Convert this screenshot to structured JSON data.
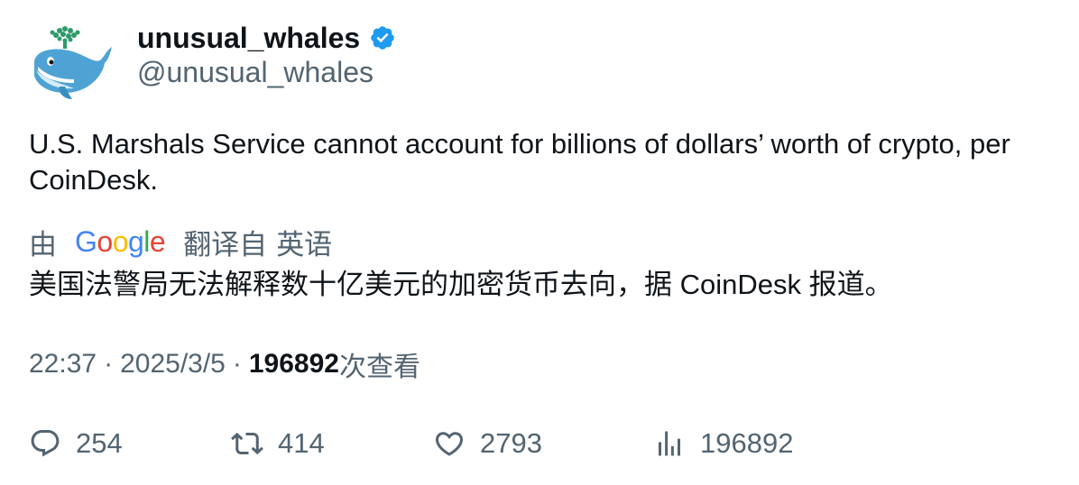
{
  "author": {
    "display_name": "unusual_whales",
    "handle": "@unusual_whales",
    "verified": true,
    "avatar_icon": "whale-logo-icon"
  },
  "tweet": {
    "text": "U.S. Marshals Service cannot account for billions of dollars’ worth of crypto, per CoinDesk."
  },
  "translation": {
    "by_label": "由",
    "provider": "Google",
    "translated_from_label": "翻译自",
    "source_language": "英语",
    "text": "美国法警局无法解释数十亿美元的加密货币去向，据 CoinDesk 报道。"
  },
  "meta": {
    "time": "22:37",
    "separator": "·",
    "date": "2025/3/5",
    "views_count": "196892",
    "views_label": "次查看"
  },
  "actions": {
    "reply": {
      "icon": "reply-icon",
      "count": "254"
    },
    "retweet": {
      "icon": "retweet-icon",
      "count": "414"
    },
    "like": {
      "icon": "heart-icon",
      "count": "2793"
    },
    "views": {
      "icon": "views-bar-chart-icon",
      "count": "196892"
    }
  },
  "colors": {
    "text_primary": "#0f1419",
    "text_secondary": "#536471",
    "verified_blue": "#1d9bf0",
    "whale_blue": "#4ea3d4",
    "spout_green": "#2e9a6a"
  }
}
